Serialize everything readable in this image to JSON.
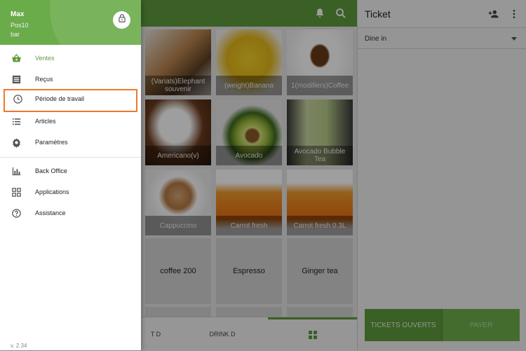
{
  "drawer": {
    "user_name": "Max",
    "pos_name": "Pos10",
    "store_name": "bar",
    "items": [
      {
        "label": "Ventes",
        "icon": "basket-icon"
      },
      {
        "label": "Reçus",
        "icon": "receipt-icon"
      },
      {
        "label": "Période de travail",
        "icon": "clock-icon"
      },
      {
        "label": "Articles",
        "icon": "list-icon"
      },
      {
        "label": "Paramètres",
        "icon": "gear-icon"
      },
      {
        "label": "Back Office",
        "icon": "bar-chart-icon"
      },
      {
        "label": "Applications",
        "icon": "apps-icon"
      },
      {
        "label": "Assistance",
        "icon": "help-icon"
      }
    ],
    "version": "v. 2.34"
  },
  "grid": {
    "tiles": [
      {
        "label": "(Variats)Elephant souvenir"
      },
      {
        "label": "(weight)Banana"
      },
      {
        "label": "1(modifiers)Coffee"
      },
      {
        "label": "Americano(v)"
      },
      {
        "label": "Avocado"
      },
      {
        "label": "Avocado Bubble Tea"
      },
      {
        "label": "Cappuccino"
      },
      {
        "label": "Carrot fresh"
      },
      {
        "label": "Carrot fresh 0.3L"
      },
      {
        "label": "coffee 200"
      },
      {
        "label": "Espresso"
      },
      {
        "label": "Ginger tea"
      }
    ]
  },
  "bottom_tabs": {
    "tab1": "T D",
    "tab2": "DRINK D"
  },
  "ticket": {
    "title": "Ticket",
    "dining_option": "Dine in",
    "open_tickets_label": "TICKETS OUVERTS",
    "pay_label": "PAYER"
  },
  "colors": {
    "accent": "#5e9c3e",
    "highlight": "#f0782c"
  }
}
